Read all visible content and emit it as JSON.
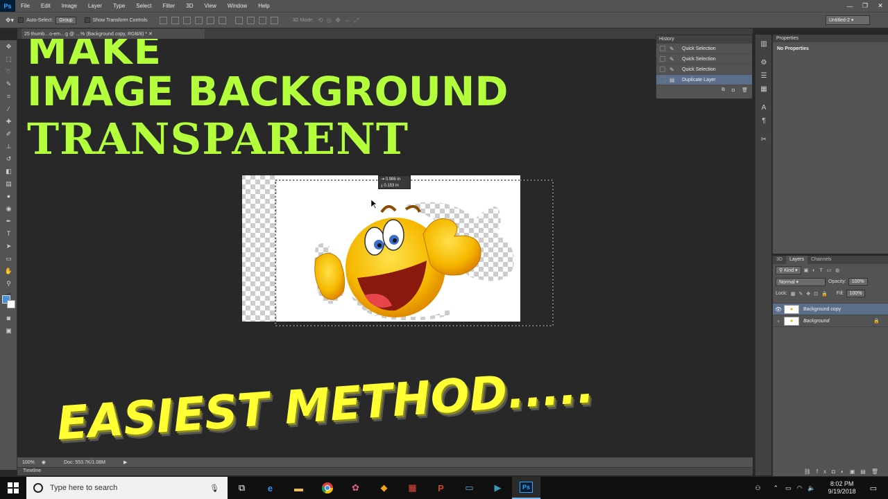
{
  "app": {
    "logo": "Ps"
  },
  "menu": [
    "File",
    "Edit",
    "Image",
    "Layer",
    "Type",
    "Select",
    "Filter",
    "3D",
    "View",
    "Window",
    "Help"
  ],
  "window_controls": [
    "—",
    "❐",
    "✕"
  ],
  "options_bar": {
    "auto_select_label": "Auto-Select:",
    "auto_select_value": "Group",
    "transform_label": "Show Transform Controls",
    "mode_3d_label": "3D Mode:",
    "workspace": "Untitled-2"
  },
  "document_tab": "25 thumb…o-em…g @ …% (Background copy, RGB/8) *",
  "status": {
    "zoom": "100%",
    "doc": "Doc: 553.7K/1.08M"
  },
  "timeline_label": "Timeline",
  "history": {
    "title": "History",
    "items": [
      {
        "label": "Quick Selection",
        "selected": false
      },
      {
        "label": "Quick Selection",
        "selected": false
      },
      {
        "label": "Quick Selection",
        "selected": false
      },
      {
        "label": "Duplicate Layer",
        "selected": true
      }
    ]
  },
  "properties": {
    "title": "Properties",
    "empty_text": "No Properties"
  },
  "layers_panel": {
    "tabs": [
      "3D",
      "Layers",
      "Channels"
    ],
    "active_tab": "Layers",
    "filter": "Kind",
    "blend_mode": "Normal",
    "opacity_label": "Opacity:",
    "opacity": "100%",
    "lock_label": "Lock:",
    "fill_label": "Fill:",
    "fill": "100%",
    "layers": [
      {
        "name": "Background copy",
        "selected": true
      },
      {
        "name": "Background",
        "selected": false
      }
    ]
  },
  "measure": {
    "dx": "0.986 in",
    "dy": "0.153 in"
  },
  "overlay_text": {
    "line1": "MAKE",
    "line2": "IMAGE BACKGROUND",
    "line3": "TRANSPARENT",
    "bottom": "EASIEST METHOD....."
  },
  "taskbar": {
    "search_placeholder": "Type here to search",
    "time": "8:02 PM",
    "date": "9/19/2018"
  },
  "colors": {
    "accent_green": "#b4ff3c",
    "accent_yellow": "#ffff33",
    "ps_blue": "#31a8ff"
  }
}
